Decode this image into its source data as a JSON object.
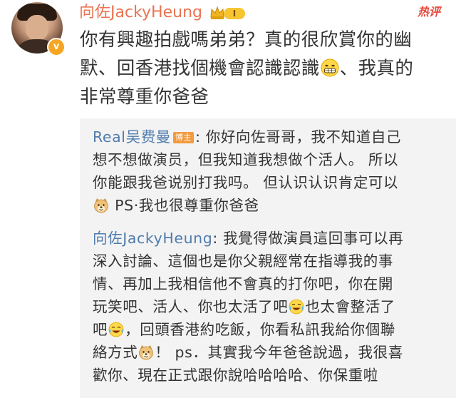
{
  "comment": {
    "username": "向佐JackyHeung",
    "verified_mark": "v",
    "vip_level": "Ⅰ",
    "hot_label": "热评",
    "text_lines": [
      "你有興趣拍戲嗎弟弟？真的很欣賞你的幽",
      "默、回香港找個機會認識認識",
      "、我真的",
      "非常尊重你爸爸"
    ]
  },
  "replies": [
    {
      "author": "Real吴费曼",
      "badge": "博主",
      "lines": [
        ": 你好向佐哥哥，我不知道自己",
        "想不想做演员，但我知道我想做个活人。 所以",
        "你能跟我爸说别打我吗。 但认识认识肯定可以",
        " PS·我也很尊重你爸爸"
      ]
    },
    {
      "author": "向佐JackyHeung",
      "lines": [
        ": 我覺得做演員這回事可以再",
        "深入討論、這個也是你父親經常在指導我的事",
        "情、再加上我相信他不會真的打你吧，你在開",
        "玩笑吧、活人、你也太活了吧",
        "也太會整活了",
        "吧",
        "，回頭香港約吃飯，你看私訊我給你個聯",
        "絡方式",
        "！ ps．其實我今年爸爸說過，我很喜",
        "歡你、現在正式跟你說哈哈哈哈、你保重啦"
      ]
    }
  ],
  "icons": {
    "avatar": "user-avatar-photo",
    "verified": "verified-badge-icon",
    "vip": "vip-crown-icon",
    "grin_emoji": "grin-emoji-icon",
    "doge_emoji": "doge-emoji-icon",
    "laugh_cry_emoji": "laugh-cry-emoji-icon",
    "smug_emoji": "smug-doge-emoji-icon"
  },
  "colors": {
    "username": "#eb7350",
    "reply_author": "#4f7cae",
    "text": "#333333",
    "reply_bg": "#f3f3f3",
    "hot": "#e64a3c",
    "verified_badge": "#f6a623",
    "blogger_tag": "#f39a3d"
  }
}
